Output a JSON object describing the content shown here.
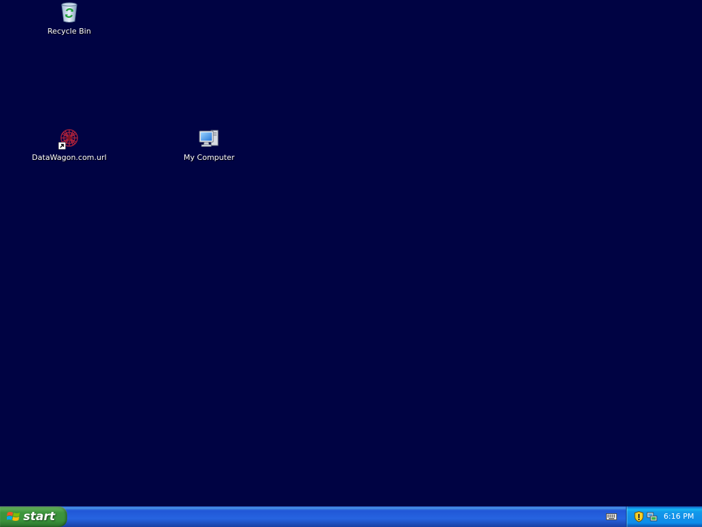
{
  "desktop": {
    "background_color": "#000343",
    "icons": [
      {
        "label": "Recycle Bin",
        "icon": "recycle-bin-icon"
      },
      {
        "label": "DataWagon.com.url",
        "icon": "internet-shortcut-icon"
      },
      {
        "label": "My Computer",
        "icon": "my-computer-icon"
      }
    ]
  },
  "taskbar": {
    "start_label": "start",
    "colors": {
      "taskbar": "#2663e0",
      "start_button": "#3d953d",
      "tray": "#1290e8"
    },
    "tray": {
      "icons": [
        "security-shield-icon",
        "network-icon"
      ],
      "clock": "6:16 PM"
    },
    "language_bar_icon": "keyboard-icon"
  }
}
